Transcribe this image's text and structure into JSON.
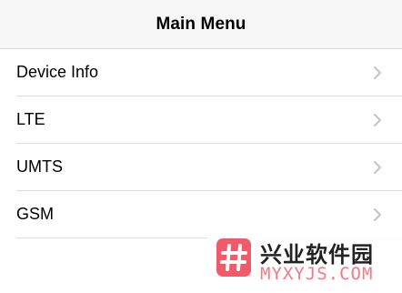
{
  "nav": {
    "title": "Main Menu"
  },
  "menu": {
    "items": [
      {
        "label": "Device Info",
        "icon": "chevron-right-icon"
      },
      {
        "label": "LTE",
        "icon": "chevron-right-icon"
      },
      {
        "label": "UMTS",
        "icon": "chevron-right-icon"
      },
      {
        "label": "GSM",
        "icon": "chevron-right-icon"
      }
    ]
  },
  "watermark": {
    "text_cn": "兴业软件园",
    "text_en": "MYXYJS.COM",
    "logo_color": "#f05a6a"
  },
  "colors": {
    "nav_bg": "#f7f7f7",
    "separator": "#dcdcdc",
    "chevron": "#c4c4c8"
  }
}
